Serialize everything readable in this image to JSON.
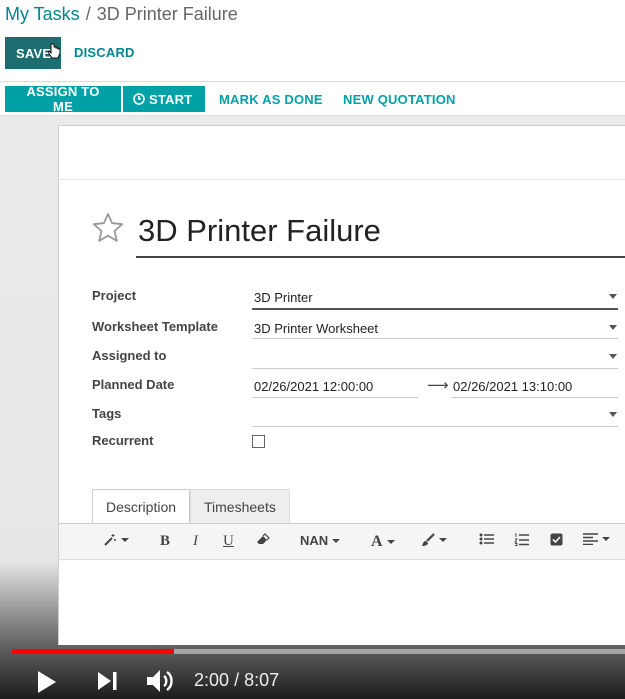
{
  "breadcrumb": {
    "parent": "My Tasks",
    "separator": "/",
    "current": "3D Printer Failure"
  },
  "actions": {
    "save": "SAVE",
    "discard": "DISCARD"
  },
  "statusbar": {
    "assign": "ASSIGN TO ME",
    "start": "START",
    "mark_done": "MARK AS DONE",
    "new_quotation": "NEW QUOTATION"
  },
  "task": {
    "title": "3D Printer Failure",
    "fields": {
      "project": {
        "label": "Project",
        "value": "3D Printer"
      },
      "worksheet": {
        "label": "Worksheet Template",
        "value": "3D Printer Worksheet"
      },
      "assigned": {
        "label": "Assigned to",
        "value": ""
      },
      "planned": {
        "label": "Planned Date",
        "start": "02/26/2021 12:00:00",
        "end": "02/26/2021 13:10:00"
      },
      "tags": {
        "label": "Tags",
        "value": ""
      },
      "recurrent": {
        "label": "Recurrent",
        "checked": false
      }
    }
  },
  "tabs": [
    {
      "label": "Description",
      "active": true
    },
    {
      "label": "Timesheets",
      "active": false
    }
  ],
  "editor": {
    "font_size": "NAN",
    "bold": "B",
    "italic": "I",
    "underline": "U",
    "font_color": "A"
  },
  "player": {
    "current": "2:00",
    "separator": "/",
    "duration": "8:07",
    "progress": 0.264
  },
  "colors": {
    "primary": "#01a1a6",
    "save": "#1b6d6f",
    "progress": "#ff0000"
  }
}
